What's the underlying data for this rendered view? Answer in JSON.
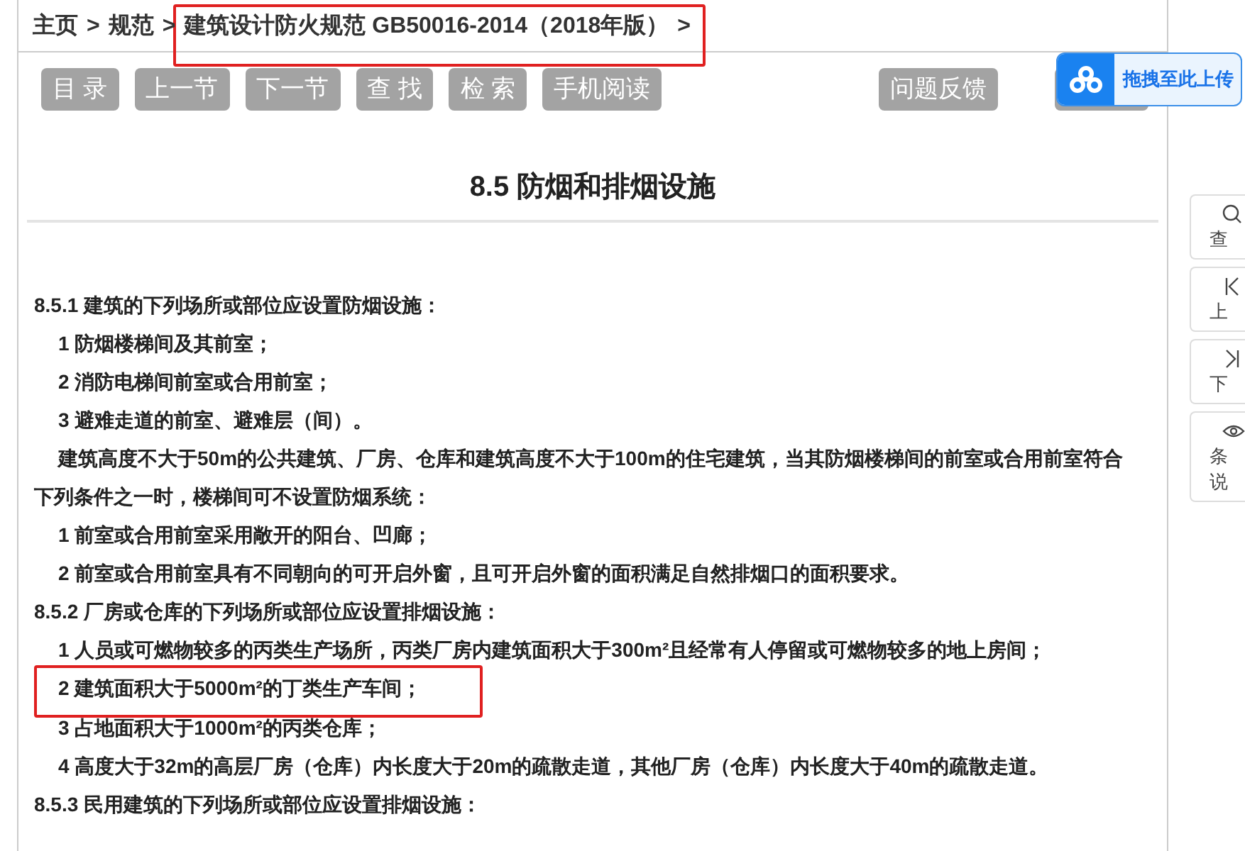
{
  "breadcrumb": [
    {
      "text": "主页",
      "separator": ">",
      "highlighted": false
    },
    {
      "text": "规范",
      "separator": ">",
      "highlighted": false
    },
    {
      "text": "建筑设计防火规范 GB50016-2014（2018年版）",
      "separator": ">",
      "highlighted": true
    }
  ],
  "toolbar": {
    "left": [
      "目 录",
      "上一节",
      "下一节",
      "查 找",
      "检 索",
      "手机阅读"
    ],
    "right": [
      "问题反馈"
    ]
  },
  "upload_widget": {
    "label": "拖拽至此上传"
  },
  "side_tabs": [
    {
      "lines": [
        "查"
      ]
    },
    {
      "lines": [
        "上"
      ]
    },
    {
      "lines": [
        "下"
      ]
    },
    {
      "lines": [
        "条",
        "说"
      ]
    }
  ],
  "section_title": "8.5 防烟和排烟设施",
  "content": [
    {
      "kind": "clause",
      "text": "8.5.1 建筑的下列场所或部位应设置防烟设施：",
      "highlighted": false
    },
    {
      "kind": "item",
      "text": "1 防烟楼梯间及其前室；",
      "highlighted": false
    },
    {
      "kind": "item",
      "text": "2 消防电梯间前室或合用前室；",
      "highlighted": false
    },
    {
      "kind": "item",
      "text": "3 避难走道的前室、避难层（间）。",
      "highlighted": false
    },
    {
      "kind": "paragraph",
      "text": "建筑高度不大于50m的公共建筑、厂房、仓库和建筑高度不大于100m的住宅建筑，当其防烟楼梯间的前室或合用前室符合下列条件之一时，楼梯间可不设置防烟系统：",
      "highlighted": false
    },
    {
      "kind": "item",
      "text": "1 前室或合用前室采用敞开的阳台、凹廊；",
      "highlighted": false
    },
    {
      "kind": "item",
      "text": "2 前室或合用前室具有不同朝向的可开启外窗，且可开启外窗的面积满足自然排烟口的面积要求。",
      "highlighted": false
    },
    {
      "kind": "clause",
      "text": "8.5.2 厂房或仓库的下列场所或部位应设置排烟设施：",
      "highlighted": false
    },
    {
      "kind": "item",
      "text": "1 人员或可燃物较多的丙类生产场所，丙类厂房内建筑面积大于300m²且经常有人停留或可燃物较多的地上房间；",
      "highlighted": false
    },
    {
      "kind": "item",
      "text": "2 建筑面积大于5000m²的丁类生产车间；",
      "highlighted": true
    },
    {
      "kind": "item",
      "text": "3 占地面积大于1000m²的丙类仓库；",
      "highlighted": false
    },
    {
      "kind": "item",
      "text": "4 高度大于32m的高层厂房（仓库）内长度大于20m的疏散走道，其他厂房（仓库）内长度大于40m的疏散走道。",
      "highlighted": false
    },
    {
      "kind": "clause",
      "text": "8.5.3 民用建筑的下列场所或部位应设置排烟设施：",
      "highlighted": false
    }
  ]
}
